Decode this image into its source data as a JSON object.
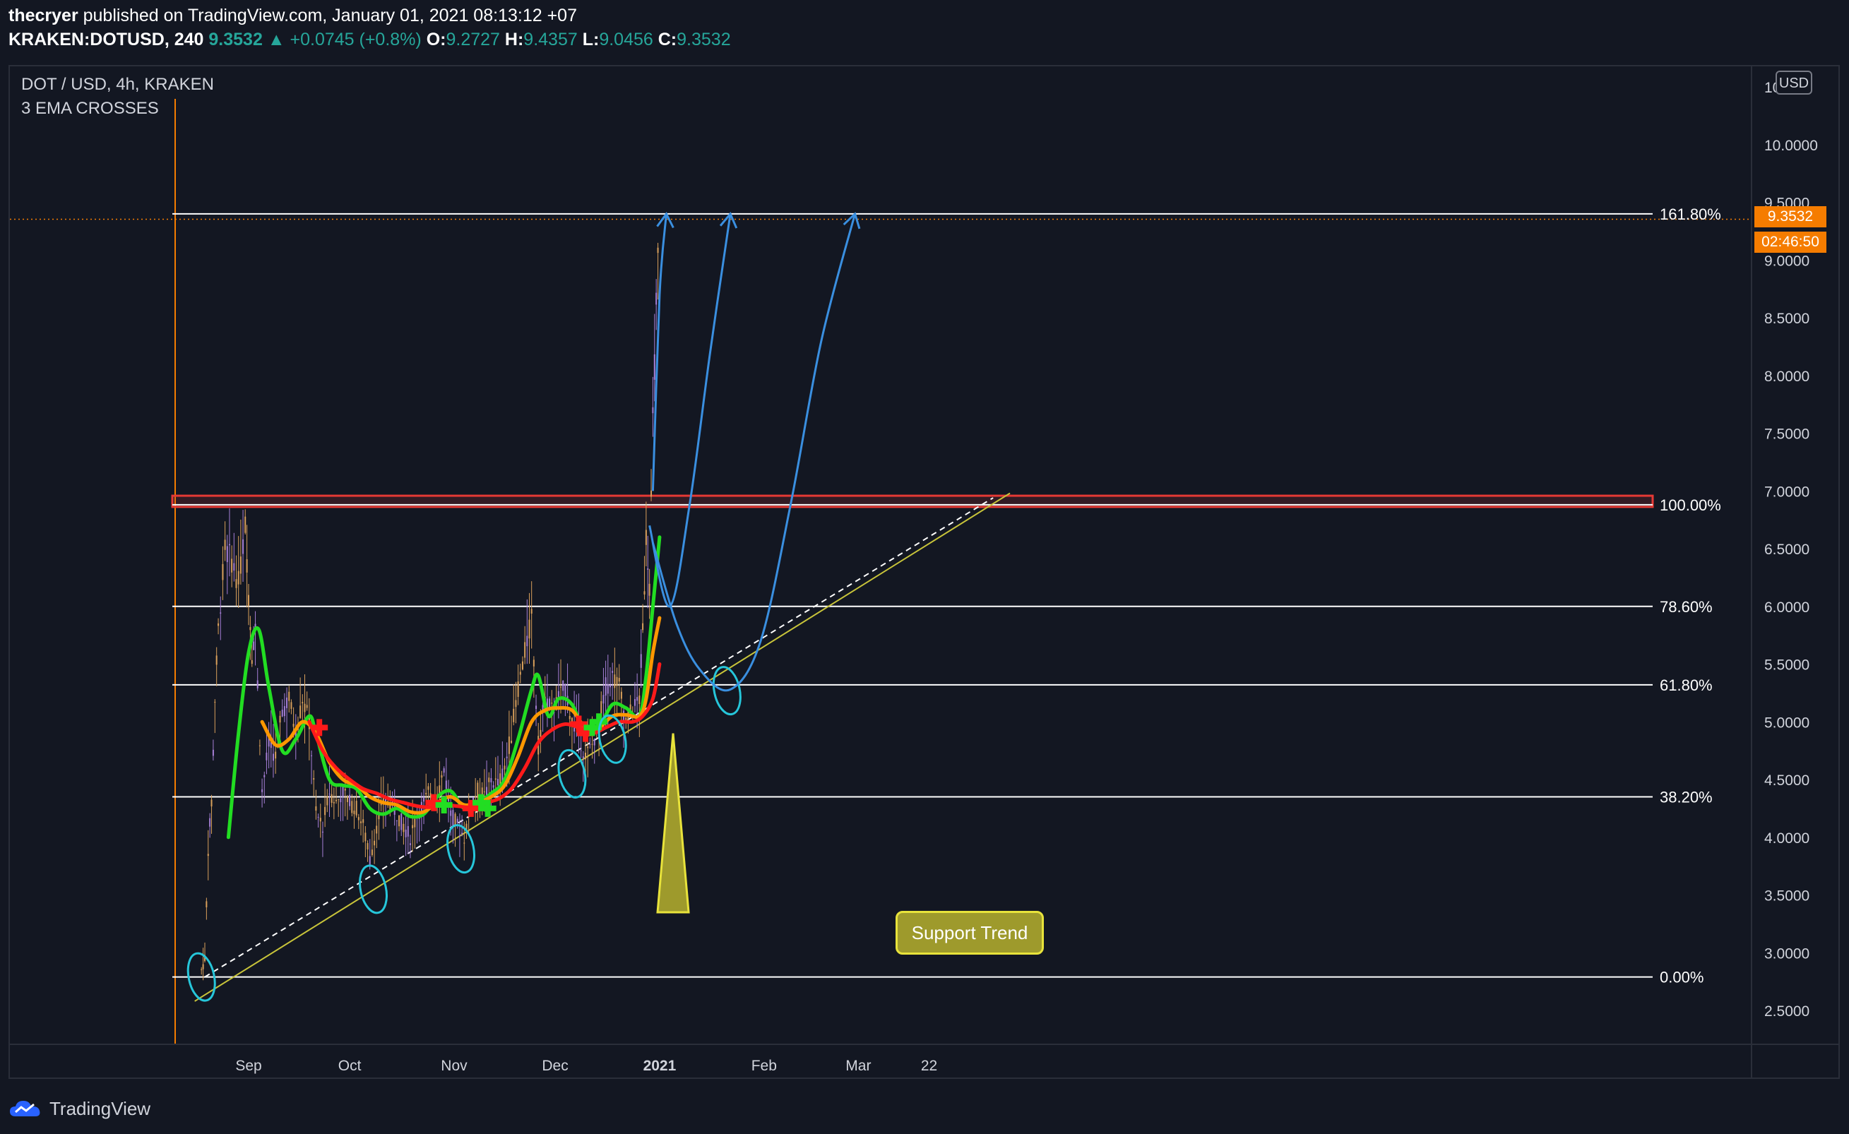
{
  "header": {
    "author": "thecryer",
    "published_text": "published on TradingView.com, January 01, 2021 08:13:12 +07",
    "symbol": "KRAKEN:DOTUSD, 240",
    "last": "9.3532",
    "change": "▲ +0.0745 (+0.8%)",
    "o_label": "O:",
    "o_value": "9.2727",
    "h_label": "H:",
    "h_value": "9.4357",
    "l_label": "L:",
    "l_value": "9.0456",
    "c_label": "C:",
    "c_value": "9.3532"
  },
  "legend": {
    "title": "DOT / USD, 4h, KRAKEN",
    "indicator": "3 EMA CROSSES"
  },
  "currency_button": "USD",
  "price_tag": "9.3532",
  "countdown_tag": "02:46:50",
  "annotation": "Support Trend",
  "footer_logo": "TradingView",
  "colors": {
    "background": "#131722",
    "candles": "#d9a05b",
    "candles_alt": "#a67fd6",
    "ema_fast": "#22dd22",
    "ema_mid": "#ff9800",
    "ema_slow": "#ff1a1a",
    "projection": "#3a8fe0",
    "circles": "#26c6da",
    "support": "#c8c43a",
    "fib_lines": "#ffffff",
    "resistance": "#e53935",
    "accent": "#f57c00"
  },
  "chart_data": {
    "type": "line",
    "title": "DOT / USD, 4h, KRAKEN",
    "price_axis": {
      "min": 2.5,
      "max": 10.5,
      "ticks": [
        "10.0000",
        "9.5000",
        "9.0000",
        "8.5000",
        "8.0000",
        "7.5000",
        "7.0000",
        "6.5000",
        "6.0000",
        "5.5000",
        "5.0000",
        "4.5000",
        "4.0000",
        "3.5000",
        "3.0000",
        "2.5000"
      ],
      "top_partial_label": "10"
    },
    "time_axis": {
      "labels": [
        {
          "label": "Sep",
          "date": "2020-09-01"
        },
        {
          "label": "Oct",
          "date": "2020-10-01"
        },
        {
          "label": "Nov",
          "date": "2020-11-01"
        },
        {
          "label": "Dec",
          "date": "2020-12-01"
        },
        {
          "label": "2021",
          "date": "2021-01-01",
          "bold": true
        },
        {
          "label": "Feb",
          "date": "2021-02-01"
        },
        {
          "label": "Mar",
          "date": "2021-03-01"
        },
        {
          "label": "22",
          "date": "2021-03-22"
        }
      ]
    },
    "fibonacci": [
      {
        "label": "161.80%",
        "price": 9.4
      },
      {
        "label": "100.00%",
        "price": 6.88
      },
      {
        "label": "78.60%",
        "price": 6.0
      },
      {
        "label": "61.80%",
        "price": 5.32
      },
      {
        "label": "38.20%",
        "price": 4.35
      },
      {
        "label": "0.00%",
        "price": 2.79
      }
    ],
    "resistance_band": {
      "low": 6.88,
      "high": 6.94
    },
    "support_trendline": {
      "from": {
        "date": "2020-08-16",
        "price": 2.58
      },
      "to": {
        "date": "2021-04-15",
        "price": 6.98
      }
    },
    "support_dashed": {
      "from": {
        "date": "2020-08-19",
        "price": 2.79
      },
      "to": {
        "date": "2021-04-10",
        "price": 6.94
      }
    },
    "series": [
      {
        "name": "DOT / USD",
        "kind": "price",
        "points": [
          [
            "2020-08-18",
            2.85
          ],
          [
            "2020-08-19",
            2.95
          ],
          [
            "2020-08-20",
            3.9
          ],
          [
            "2020-08-21",
            4.3
          ],
          [
            "2020-08-22",
            5.2
          ],
          [
            "2020-08-23",
            5.8
          ],
          [
            "2020-08-25",
            6.5
          ],
          [
            "2020-08-27",
            6.4
          ],
          [
            "2020-08-29",
            6.2
          ],
          [
            "2020-08-31",
            6.7
          ],
          [
            "2020-09-01",
            6.1
          ],
          [
            "2020-09-02",
            5.6
          ],
          [
            "2020-09-03",
            5.8
          ],
          [
            "2020-09-05",
            4.4
          ],
          [
            "2020-09-07",
            4.8
          ],
          [
            "2020-09-09",
            4.7
          ],
          [
            "2020-09-11",
            5.1
          ],
          [
            "2020-09-13",
            5.2
          ],
          [
            "2020-09-15",
            4.9
          ],
          [
            "2020-09-17",
            5.2
          ],
          [
            "2020-09-19",
            5.0
          ],
          [
            "2020-09-21",
            4.2
          ],
          [
            "2020-09-23",
            4.1
          ],
          [
            "2020-09-25",
            4.4
          ],
          [
            "2020-09-27",
            4.3
          ],
          [
            "2020-09-29",
            4.4
          ],
          [
            "2020-10-01",
            4.3
          ],
          [
            "2020-10-03",
            4.25
          ],
          [
            "2020-10-05",
            4.1
          ],
          [
            "2020-10-07",
            3.8
          ],
          [
            "2020-10-09",
            4.1
          ],
          [
            "2020-10-11",
            4.3
          ],
          [
            "2020-10-13",
            4.3
          ],
          [
            "2020-10-15",
            4.2
          ],
          [
            "2020-10-17",
            4.1
          ],
          [
            "2020-10-19",
            4.0
          ],
          [
            "2020-10-21",
            4.2
          ],
          [
            "2020-10-23",
            4.3
          ],
          [
            "2020-10-25",
            4.4
          ],
          [
            "2020-10-27",
            4.35
          ],
          [
            "2020-10-29",
            4.6
          ],
          [
            "2020-10-31",
            4.2
          ],
          [
            "2020-11-02",
            4.1
          ],
          [
            "2020-11-04",
            4.0
          ],
          [
            "2020-11-06",
            4.3
          ],
          [
            "2020-11-08",
            4.4
          ],
          [
            "2020-11-10",
            4.35
          ],
          [
            "2020-11-12",
            4.5
          ],
          [
            "2020-11-14",
            4.45
          ],
          [
            "2020-11-16",
            4.6
          ],
          [
            "2020-11-18",
            4.9
          ],
          [
            "2020-11-20",
            5.3
          ],
          [
            "2020-11-22",
            5.6
          ],
          [
            "2020-11-24",
            5.9
          ],
          [
            "2020-11-26",
            4.8
          ],
          [
            "2020-11-28",
            5.2
          ],
          [
            "2020-11-30",
            5.1
          ],
          [
            "2020-12-02",
            5.2
          ],
          [
            "2020-12-04",
            5.3
          ],
          [
            "2020-12-06",
            5.0
          ],
          [
            "2020-12-08",
            4.9
          ],
          [
            "2020-12-10",
            4.7
          ],
          [
            "2020-12-12",
            4.8
          ],
          [
            "2020-12-14",
            5.0
          ],
          [
            "2020-12-16",
            5.3
          ],
          [
            "2020-12-18",
            5.4
          ],
          [
            "2020-12-20",
            5.3
          ],
          [
            "2020-12-22",
            5.0
          ],
          [
            "2020-12-24",
            5.1
          ],
          [
            "2020-12-26",
            5.2
          ],
          [
            "2020-12-27",
            5.8
          ],
          [
            "2020-12-28",
            6.6
          ],
          [
            "2020-12-29",
            6.2
          ],
          [
            "2020-12-30",
            7.6
          ],
          [
            "2020-12-31",
            8.6
          ],
          [
            "2021-01-01",
            9.35
          ]
        ]
      },
      {
        "name": "EMA fast",
        "color": "#22dd22",
        "points": [
          [
            "2020-08-26",
            4.0
          ],
          [
            "2020-08-29",
            4.9
          ],
          [
            "2020-09-01",
            5.6
          ],
          [
            "2020-09-04",
            5.8
          ],
          [
            "2020-09-07",
            5.3
          ],
          [
            "2020-09-11",
            4.75
          ],
          [
            "2020-09-15",
            4.85
          ],
          [
            "2020-09-19",
            5.05
          ],
          [
            "2020-09-21",
            4.9
          ],
          [
            "2020-09-25",
            4.5
          ],
          [
            "2020-09-29",
            4.45
          ],
          [
            "2020-10-03",
            4.42
          ],
          [
            "2020-10-07",
            4.25
          ],
          [
            "2020-10-11",
            4.2
          ],
          [
            "2020-10-15",
            4.25
          ],
          [
            "2020-10-19",
            4.18
          ],
          [
            "2020-10-23",
            4.2
          ],
          [
            "2020-10-27",
            4.35
          ],
          [
            "2020-10-31",
            4.4
          ],
          [
            "2020-11-04",
            4.25
          ],
          [
            "2020-11-08",
            4.3
          ],
          [
            "2020-11-12",
            4.38
          ],
          [
            "2020-11-16",
            4.5
          ],
          [
            "2020-11-20",
            4.85
          ],
          [
            "2020-11-24",
            5.28
          ],
          [
            "2020-11-26",
            5.4
          ],
          [
            "2020-11-29",
            5.05
          ],
          [
            "2020-12-02",
            5.2
          ],
          [
            "2020-12-06",
            5.15
          ],
          [
            "2020-12-10",
            4.9
          ],
          [
            "2020-12-14",
            4.95
          ],
          [
            "2020-12-18",
            5.15
          ],
          [
            "2020-12-22",
            5.12
          ],
          [
            "2020-12-26",
            5.05
          ],
          [
            "2020-12-28",
            5.4
          ],
          [
            "2020-12-30",
            6.0
          ],
          [
            "2021-01-01",
            6.6
          ]
        ]
      },
      {
        "name": "EMA mid",
        "color": "#ff9800",
        "points": [
          [
            "2020-09-05",
            5.0
          ],
          [
            "2020-09-09",
            4.8
          ],
          [
            "2020-09-13",
            4.85
          ],
          [
            "2020-09-17",
            5.0
          ],
          [
            "2020-09-21",
            4.9
          ],
          [
            "2020-09-25",
            4.65
          ],
          [
            "2020-09-29",
            4.5
          ],
          [
            "2020-10-03",
            4.45
          ],
          [
            "2020-10-07",
            4.35
          ],
          [
            "2020-10-11",
            4.3
          ],
          [
            "2020-10-15",
            4.28
          ],
          [
            "2020-10-19",
            4.22
          ],
          [
            "2020-10-23",
            4.22
          ],
          [
            "2020-10-27",
            4.3
          ],
          [
            "2020-10-31",
            4.35
          ],
          [
            "2020-11-04",
            4.28
          ],
          [
            "2020-11-08",
            4.3
          ],
          [
            "2020-11-12",
            4.35
          ],
          [
            "2020-11-16",
            4.45
          ],
          [
            "2020-11-20",
            4.7
          ],
          [
            "2020-11-24",
            5.0
          ],
          [
            "2020-11-28",
            5.1
          ],
          [
            "2020-12-02",
            5.12
          ],
          [
            "2020-12-06",
            5.1
          ],
          [
            "2020-12-10",
            4.95
          ],
          [
            "2020-12-14",
            4.95
          ],
          [
            "2020-12-18",
            5.05
          ],
          [
            "2020-12-22",
            5.06
          ],
          [
            "2020-12-26",
            5.05
          ],
          [
            "2020-12-28",
            5.2
          ],
          [
            "2020-12-30",
            5.6
          ],
          [
            "2021-01-01",
            5.9
          ]
        ]
      },
      {
        "name": "EMA slow",
        "color": "#ff1a1a",
        "points": [
          [
            "2020-09-19",
            5.0
          ],
          [
            "2020-09-23",
            4.75
          ],
          [
            "2020-09-27",
            4.6
          ],
          [
            "2020-10-01",
            4.5
          ],
          [
            "2020-10-05",
            4.42
          ],
          [
            "2020-10-09",
            4.38
          ],
          [
            "2020-10-13",
            4.33
          ],
          [
            "2020-10-17",
            4.3
          ],
          [
            "2020-10-21",
            4.27
          ],
          [
            "2020-10-25",
            4.26
          ],
          [
            "2020-10-29",
            4.28
          ],
          [
            "2020-11-02",
            4.27
          ],
          [
            "2020-11-06",
            4.26
          ],
          [
            "2020-11-10",
            4.3
          ],
          [
            "2020-11-14",
            4.33
          ],
          [
            "2020-11-18",
            4.42
          ],
          [
            "2020-11-22",
            4.6
          ],
          [
            "2020-11-26",
            4.82
          ],
          [
            "2020-11-30",
            4.93
          ],
          [
            "2020-12-04",
            4.98
          ],
          [
            "2020-12-08",
            4.95
          ],
          [
            "2020-12-12",
            4.9
          ],
          [
            "2020-12-16",
            4.95
          ],
          [
            "2020-12-20",
            5.0
          ],
          [
            "2020-12-24",
            5.0
          ],
          [
            "2020-12-27",
            5.05
          ],
          [
            "2020-12-30",
            5.2
          ],
          [
            "2021-01-01",
            5.5
          ]
        ]
      }
    ],
    "ema_crosses": [
      {
        "date": "2020-09-22",
        "price": 4.95,
        "color": "#ff1a1a"
      },
      {
        "date": "2020-10-26",
        "price": 4.3,
        "color": "#ff1a1a"
      },
      {
        "date": "2020-10-29",
        "price": 4.28,
        "color": "#22dd22"
      },
      {
        "date": "2020-11-06",
        "price": 4.25,
        "color": "#ff1a1a"
      },
      {
        "date": "2020-11-09",
        "price": 4.3,
        "color": "#22dd22"
      },
      {
        "date": "2020-11-11",
        "price": 4.25,
        "color": "#22dd22"
      },
      {
        "date": "2020-12-08",
        "price": 4.98,
        "color": "#ff1a1a"
      },
      {
        "date": "2020-12-10",
        "price": 4.9,
        "color": "#ff1a1a"
      },
      {
        "date": "2020-12-12",
        "price": 4.95,
        "color": "#22dd22"
      },
      {
        "date": "2020-12-14",
        "price": 5.0,
        "color": "#22dd22"
      }
    ],
    "touch_circles": [
      {
        "date": "2020-08-18",
        "price": 2.79
      },
      {
        "date": "2020-10-08",
        "price": 3.55
      },
      {
        "date": "2020-11-03",
        "price": 3.9
      },
      {
        "date": "2020-12-06",
        "price": 4.55
      },
      {
        "date": "2020-12-18",
        "price": 4.85
      },
      {
        "date": "2021-01-21",
        "price": 5.27
      }
    ],
    "projections": [
      {
        "points": [
          [
            "2020-12-30",
            7.0
          ],
          [
            "2021-01-01",
            8.7
          ],
          [
            "2021-01-03",
            9.4
          ]
        ]
      },
      {
        "points": [
          [
            "2020-12-29",
            6.7
          ],
          [
            "2021-01-04",
            6.0
          ],
          [
            "2021-01-10",
            6.9
          ],
          [
            "2021-01-16",
            8.2
          ],
          [
            "2021-01-22",
            9.4
          ]
        ]
      },
      {
        "points": [
          [
            "2020-12-30",
            6.55
          ],
          [
            "2021-01-06",
            5.85
          ],
          [
            "2021-01-13",
            5.45
          ],
          [
            "2021-01-22",
            5.28
          ],
          [
            "2021-01-31",
            5.7
          ],
          [
            "2021-02-09",
            6.9
          ],
          [
            "2021-02-18",
            8.3
          ],
          [
            "2021-02-28",
            9.4
          ]
        ]
      }
    ],
    "annotation_pointer": {
      "date": "2021-01-05",
      "price": 4.9
    }
  }
}
